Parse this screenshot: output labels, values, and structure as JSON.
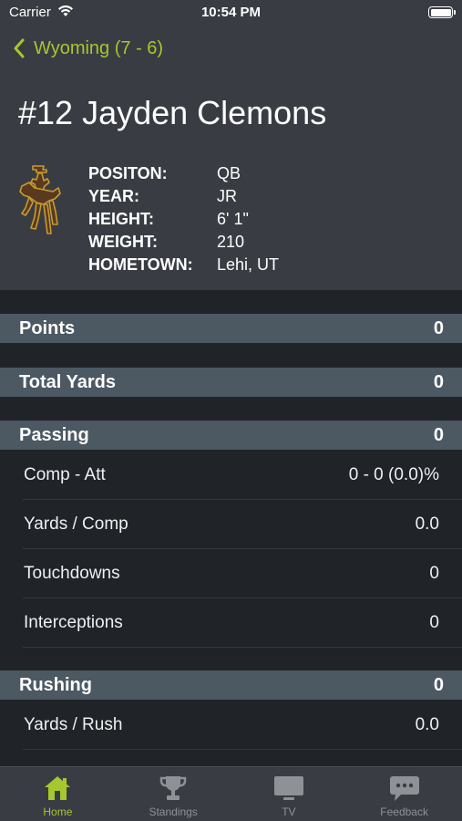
{
  "status_bar": {
    "carrier": "Carrier",
    "time": "10:54 PM"
  },
  "nav": {
    "back_label": "Wyoming (7 - 6)"
  },
  "player": {
    "name": "#12 Jayden Clemons",
    "info": [
      {
        "label": "POSITON:",
        "value": "QB"
      },
      {
        "label": "YEAR:",
        "value": "JR"
      },
      {
        "label": "HEIGHT:",
        "value": "6' 1\""
      },
      {
        "label": "WEIGHT:",
        "value": "210"
      },
      {
        "label": "HOMETOWN:",
        "value": "Lehi, UT"
      }
    ]
  },
  "sections": {
    "points": {
      "label": "Points",
      "value": "0"
    },
    "total_yards": {
      "label": "Total Yards",
      "value": "0"
    },
    "passing": {
      "label": "Passing",
      "value": "0",
      "rows": [
        {
          "label": "Comp - Att",
          "value": "0 - 0 (0.0)%"
        },
        {
          "label": "Yards / Comp",
          "value": "0.0"
        },
        {
          "label": "Touchdowns",
          "value": "0"
        },
        {
          "label": "Interceptions",
          "value": "0"
        }
      ]
    },
    "rushing": {
      "label": "Rushing",
      "value": "0",
      "rows": [
        {
          "label": "Yards / Rush",
          "value": "0.0"
        }
      ]
    }
  },
  "tabs": [
    {
      "label": "Home",
      "icon": "home-icon",
      "active": true
    },
    {
      "label": "Standings",
      "icon": "trophy-icon",
      "active": false
    },
    {
      "label": "TV",
      "icon": "tv-icon",
      "active": false
    },
    {
      "label": "Feedback",
      "icon": "feedback-icon",
      "active": false
    }
  ],
  "colors": {
    "accent": "#a6c72e",
    "header_bg": "#393d43",
    "section_bg": "#4c5862",
    "page_bg": "#202327",
    "logo_brown": "#5a3a1e",
    "logo_gold": "#c89a2e"
  }
}
